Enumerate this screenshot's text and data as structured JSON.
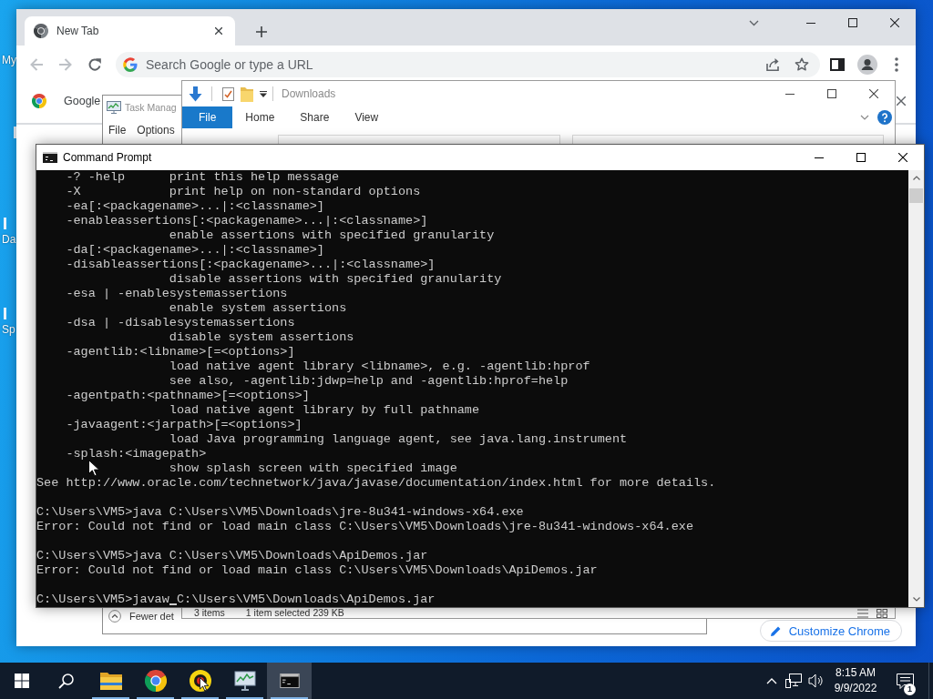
{
  "desktop": {
    "icons": [
      {
        "label": "My"
      },
      {
        "label": "Da"
      },
      {
        "label": "Sp"
      }
    ]
  },
  "browser": {
    "tabs": [
      {
        "title": "New Tab",
        "selected": true
      }
    ],
    "nav": [
      {
        "kind": "back",
        "disabled": true
      },
      {
        "kind": "forward",
        "disabled": true
      },
      {
        "kind": "reload",
        "disabled": false
      }
    ],
    "omnibox": {
      "placeholder": "Search Google or type a URL"
    },
    "infobar": {
      "label": "Google"
    },
    "customize_button": {
      "label": "Customize Chrome"
    }
  },
  "task_manager": {
    "title": "Task Manag",
    "menu": [
      {
        "label": "File"
      },
      {
        "label": "Options"
      }
    ],
    "footer_button": {
      "label": "Fewer det"
    }
  },
  "explorer": {
    "title": "Downloads",
    "ribbon_tabs": [
      {
        "label": "File",
        "selected": true
      },
      {
        "label": "Home",
        "selected": false
      },
      {
        "label": "Share",
        "selected": false
      },
      {
        "label": "View",
        "selected": false
      }
    ],
    "status_bar": {
      "item_count": "3 items",
      "selection": "1 item selected 239 KB"
    }
  },
  "command_prompt": {
    "title": "Command Prompt",
    "cursor": true,
    "blocks": [
      {
        "lines": [
          {
            "kind": "option",
            "text": "-? -help      print this help message"
          },
          {
            "kind": "option",
            "text": "-X            print help on non-standard options"
          },
          {
            "kind": "option",
            "text": "-ea[:<packagename>...|:<classname>]"
          },
          {
            "kind": "option",
            "text": "-enableassertions[:<packagename>...|:<classname>]"
          },
          {
            "kind": "description",
            "text": "enable assertions with specified granularity"
          },
          {
            "kind": "option",
            "text": "-da[:<packagename>...|:<classname>]"
          },
          {
            "kind": "option",
            "text": "-disableassertions[:<packagename>...|:<classname>]"
          },
          {
            "kind": "description",
            "text": "disable assertions with specified granularity"
          },
          {
            "kind": "option",
            "text": "-esa | -enablesystemassertions"
          },
          {
            "kind": "description",
            "text": "enable system assertions"
          },
          {
            "kind": "option",
            "text": "-dsa | -disablesystemassertions"
          },
          {
            "kind": "description",
            "text": "disable system assertions"
          },
          {
            "kind": "option",
            "text": "-agentlib:<libname>[=<options>]"
          },
          {
            "kind": "description",
            "text": "load native agent library <libname>, e.g. -agentlib:hprof"
          },
          {
            "kind": "description",
            "text": "see also, -agentlib:jdwp=help and -agentlib:hprof=help"
          },
          {
            "kind": "option",
            "text": "-agentpath:<pathname>[=<options>]"
          },
          {
            "kind": "description",
            "text": "load native agent library by full pathname"
          },
          {
            "kind": "option",
            "text": "-javaagent:<jarpath>[=<options>]"
          },
          {
            "kind": "description",
            "text": "load Java programming language agent, see java.lang.instrument"
          },
          {
            "kind": "option",
            "text": "-splash:<imagepath>"
          },
          {
            "kind": "description",
            "text": "show splash screen with specified image"
          },
          {
            "kind": "plain",
            "text": "See http://www.oracle.com/technetwork/java/javase/documentation/index.html for more details."
          }
        ]
      },
      {
        "lines": [
          {
            "kind": "plain",
            "text": "C:\\Users\\VM5>java C:\\Users\\VM5\\Downloads\\jre-8u341-windows-x64.exe"
          },
          {
            "kind": "plain",
            "text": "Error: Could not find or load main class C:\\Users\\VM5\\Downloads\\jre-8u341-windows-x64.exe"
          }
        ]
      },
      {
        "lines": [
          {
            "kind": "plain",
            "text": "C:\\Users\\VM5>java C:\\Users\\VM5\\Downloads\\ApiDemos.jar"
          },
          {
            "kind": "plain",
            "text": "Error: Could not find or load main class C:\\Users\\VM5\\Downloads\\ApiDemos.jar"
          }
        ]
      },
      {
        "lines": [
          {
            "kind": "plain",
            "text": "C:\\Users\\VM5>javaw C:\\Users\\VM5\\Downloads\\ApiDemos.jar"
          }
        ]
      }
    ]
  },
  "taskbar": {
    "apps": [
      {
        "kind": "folder",
        "running": true,
        "selected": false
      },
      {
        "kind": "browser",
        "running": true,
        "selected": false
      },
      {
        "kind": "media",
        "running": true,
        "selected": false
      },
      {
        "kind": "monitor",
        "running": true,
        "selected": false
      },
      {
        "kind": "terminal",
        "running": true,
        "selected": true
      }
    ],
    "clock": {
      "time": "8:15 AM",
      "date": "9/9/2022"
    },
    "notifications": {
      "count": "1"
    }
  }
}
